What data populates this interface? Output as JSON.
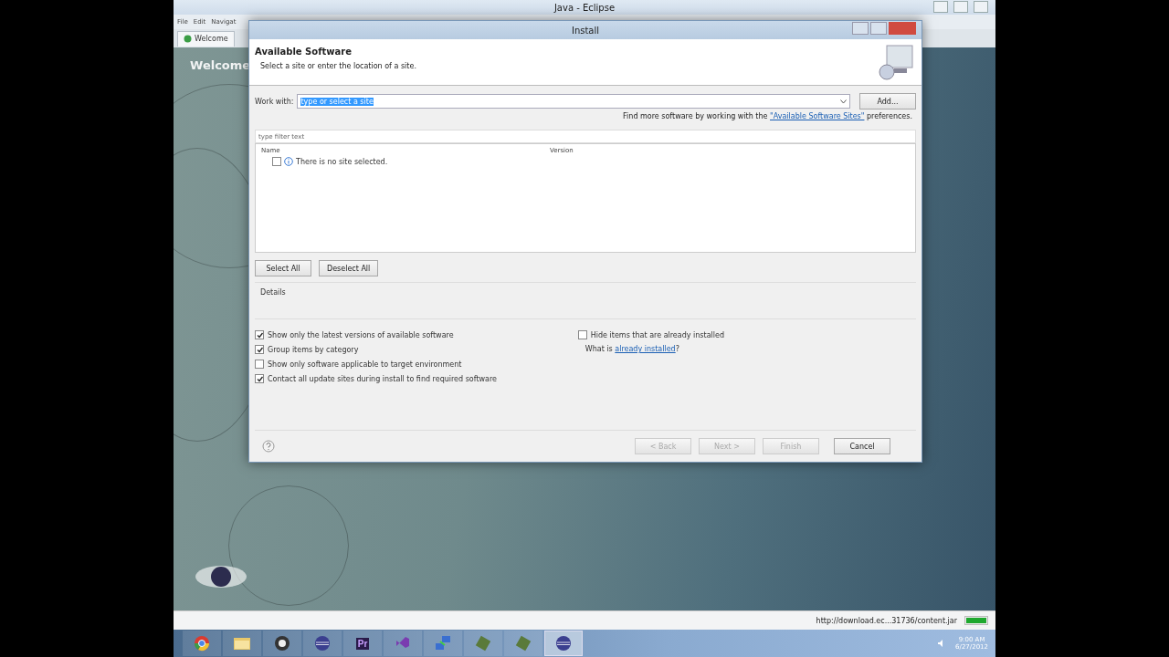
{
  "window": {
    "title": "Java - Eclipse"
  },
  "menu": [
    "File",
    "Edit",
    "Navigat"
  ],
  "editor_tab": {
    "label": "Welcome"
  },
  "welcome": {
    "heading": "Welcome"
  },
  "status_bar": {
    "url": "http://download.ec...31736/content.jar",
    "progress": {
      "level": 1
    }
  },
  "taskbar": {
    "apps": [
      {
        "kind": "chrome",
        "selected": false
      },
      {
        "kind": "folder",
        "selected": false
      },
      {
        "kind": "media",
        "selected": false
      },
      {
        "kind": "eclipse",
        "selected": false
      },
      {
        "kind": "premiere",
        "selected": false
      },
      {
        "kind": "studio",
        "selected": false
      },
      {
        "kind": "network",
        "selected": false
      },
      {
        "kind": "tool",
        "selected": false
      },
      {
        "kind": "tool",
        "selected": false
      },
      {
        "kind": "eclipse",
        "selected": true
      }
    ],
    "premiere_label": "Pr",
    "time": "9:00 AM",
    "date": "6/27/2012"
  },
  "dialog": {
    "title": "Install",
    "heading": "Available Software",
    "subtitle": "Select a site or enter the location of a site.",
    "work_with": {
      "label": "Work with:",
      "value": "type or select a site"
    },
    "add_button": "Add...",
    "find_more": {
      "before": "Find more software by working with the ",
      "link": "\"Available Software Sites\"",
      "after": " preferences."
    },
    "filter": {
      "placeholder": "type filter text"
    },
    "table": {
      "columns": [
        "Name",
        "Version"
      ],
      "rows": [
        {
          "name": "There is no site selected.",
          "checked": false
        }
      ]
    },
    "select_all": "Select All",
    "deselect_all": "Deselect All",
    "details": "Details",
    "options": [
      {
        "label": "Show only the latest versions of available software",
        "checked": true
      },
      {
        "label": "Group items by category",
        "checked": true
      },
      {
        "label": "Show only software applicable to target environment",
        "checked": false
      },
      {
        "label": "Contact all update sites during install to find required software",
        "checked": true
      }
    ],
    "hide_installed": {
      "label": "Hide items that are already installed",
      "checked": false
    },
    "what_is": {
      "before": "What is ",
      "link": "already installed",
      "after": "?"
    },
    "buttons": [
      {
        "label": "< Back",
        "disabled": true
      },
      {
        "label": "Next >",
        "disabled": true
      },
      {
        "label": "Finish",
        "disabled": true
      },
      {
        "label": "Cancel",
        "disabled": false
      }
    ]
  }
}
